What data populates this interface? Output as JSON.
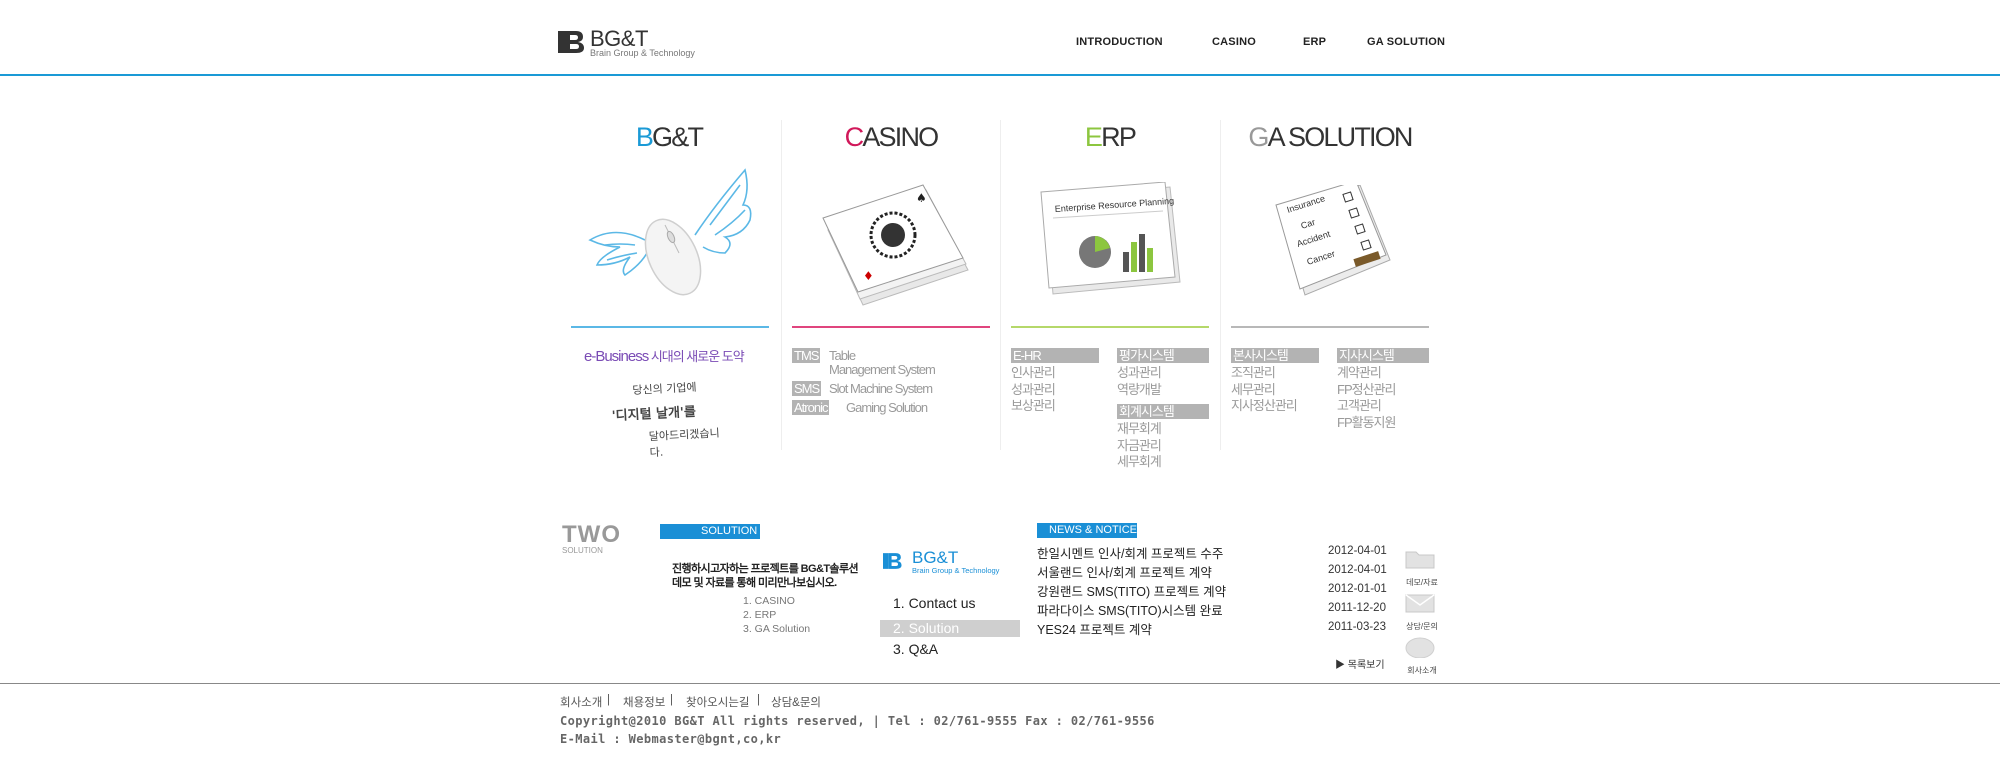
{
  "header": {
    "logo_name": "BG&T",
    "logo_sub": "Brain Group & Technology",
    "nav": [
      "INTRODUCTION",
      "CASINO",
      "ERP",
      "GA SOLUTION"
    ]
  },
  "columns": {
    "bgt": {
      "title_first": "B",
      "title_rest": "G&T",
      "accent": "#1a9ad6",
      "tagline_brand": "e-Business",
      "tagline_rest": " 시대의 새로운 도약",
      "hand_line1": "당신의 기업에",
      "hand_line2": "'디지털 날개'를",
      "hand_line3": "달아드리겠습니다."
    },
    "casino": {
      "title_first": "C",
      "title_rest": "ASINO",
      "accent": "#d1185a",
      "items": [
        {
          "tag": "TMS",
          "text1": "Table",
          "text2": "Management System"
        },
        {
          "tag": "SMS",
          "text1": "Slot Machine System"
        },
        {
          "tag": "Atronic",
          "text1": "Gaming Solution"
        }
      ]
    },
    "erp": {
      "title_first": "E",
      "title_rest": "RP",
      "accent": "#8cc63f",
      "doc_text": "Enterprise Resource Planning",
      "group1": {
        "label": "E-HR",
        "items": [
          "인사관리",
          "성과관리",
          "보상관리"
        ]
      },
      "group2": {
        "label": "평가시스템",
        "items": [
          "성과관리",
          "역량개발"
        ]
      },
      "group3": {
        "label": "회계시스템",
        "items": [
          "재무회계",
          "자금관리",
          "세무회계"
        ]
      }
    },
    "ga": {
      "title_first": "G",
      "title_rest": "A SOLUTION",
      "accent": "#999999",
      "doc_items": [
        "Insurance",
        "Car",
        "Accident",
        "Cancer"
      ],
      "group1": {
        "label": "본사시스템",
        "items": [
          "조직관리",
          "세무관리",
          "지사정산관리"
        ]
      },
      "group2": {
        "label": "지사시스템",
        "items": [
          "계약관리",
          "FP정산관리",
          "고객관리",
          "FP활동지원"
        ]
      }
    }
  },
  "solution": {
    "two_title": "TWO",
    "two_sub": "SOLUTION",
    "bar_label": "SOLUTION",
    "promo_line1": "진행하시고자하는 프로젝트를 BG&T솔루션",
    "promo_line2": "데모 및 자료를 통해 미리만나보십시오.",
    "list": [
      "1. CASINO",
      "2. ERP",
      "3. GA Solution"
    ],
    "menu_logo": "BG&T",
    "menu_logo_sub": "Brain Group & Technology",
    "menu": [
      "1. Contact us",
      "2. Solution",
      "3. Q&A"
    ]
  },
  "news": {
    "bar_label": "NEWS & NOTICE",
    "items": [
      {
        "title": "한일시멘트 인사/회계 프로젝트 수주",
        "date": "2012-04-01"
      },
      {
        "title": "서울랜드 인사/회계 프로젝트 계약",
        "date": "2012-04-01"
      },
      {
        "title": "강원랜드 SMS(TITO) 프로젝트 계약",
        "date": "2012-01-01"
      },
      {
        "title": "파라다이스 SMS(TITO)시스템 완료",
        "date": "2011-12-20"
      },
      {
        "title": "YES24 프로젝트 계약",
        "date": "2011-03-23"
      }
    ],
    "more_label": "▶ 목록보기"
  },
  "side_icons": [
    "데모/자료",
    "상담/문의",
    "회사소개"
  ],
  "footer": {
    "links": [
      "회사소개",
      "채용정보",
      "찾아오시는길",
      "상담&문의"
    ],
    "copyright": "Copyright@2010 BG&T All rights reserved,  |  Tel : 02/761-9555 Fax : 02/761-9556",
    "email": "E-Mail : Webmaster@bgnt,co,kr"
  }
}
